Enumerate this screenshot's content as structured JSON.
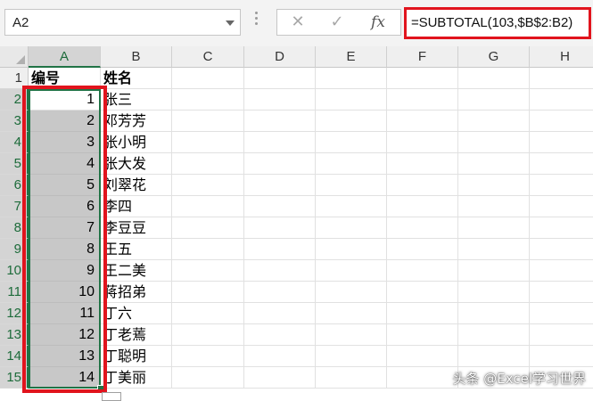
{
  "formula_bar": {
    "name_box": "A2",
    "cancel_glyph": "✕",
    "enter_glyph": "✓",
    "fx_label": "fx",
    "formula": "=SUBTOTAL(103,$B$2:B2)",
    "highlight_color": "#e1141d"
  },
  "columns": [
    "A",
    "B",
    "C",
    "D",
    "E",
    "F",
    "G",
    "H"
  ],
  "rows": [
    "1",
    "2",
    "3",
    "4",
    "5",
    "6",
    "7",
    "8",
    "9",
    "10",
    "11",
    "12",
    "13",
    "14",
    "15"
  ],
  "table": {
    "header": {
      "a": "编号",
      "b": "姓名"
    },
    "data": [
      {
        "a": "1",
        "b": "张三"
      },
      {
        "a": "2",
        "b": "邓芳芳"
      },
      {
        "a": "3",
        "b": "张小明"
      },
      {
        "a": "4",
        "b": "张大发"
      },
      {
        "a": "5",
        "b": "刘翠花"
      },
      {
        "a": "6",
        "b": "李四"
      },
      {
        "a": "7",
        "b": "李豆豆"
      },
      {
        "a": "8",
        "b": "王五"
      },
      {
        "a": "9",
        "b": "王二美"
      },
      {
        "a": "10",
        "b": "蒋招弟"
      },
      {
        "a": "11",
        "b": "丁六"
      },
      {
        "a": "12",
        "b": "丁老蔫"
      },
      {
        "a": "13",
        "b": "丁聪明"
      },
      {
        "a": "14",
        "b": "丁美丽"
      }
    ]
  },
  "selection": {
    "range_color": "#217346",
    "active_cell": "A2"
  },
  "watermark": "头条 @Excel学习世界"
}
